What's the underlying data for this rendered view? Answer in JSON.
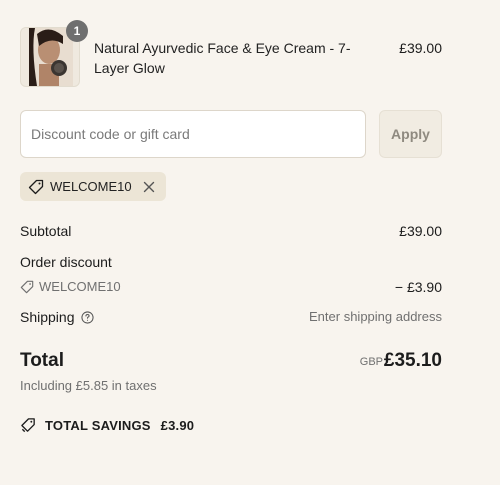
{
  "product": {
    "quantity": "1",
    "title": "Natural Ayurvedic Face & Eye Cream - 7-Layer Glow",
    "price": "£39.00"
  },
  "discount_form": {
    "placeholder": "Discount code or gift card",
    "value": "",
    "apply_label": "Apply"
  },
  "applied_tag": {
    "code": "WELCOME10"
  },
  "summary": {
    "subtotal_label": "Subtotal",
    "subtotal_value": "£39.00",
    "order_discount_label": "Order discount",
    "discount_code": "WELCOME10",
    "discount_amount": "− £3.90",
    "shipping_label": "Shipping",
    "shipping_value": "Enter shipping address",
    "total_label": "Total",
    "currency": "GBP",
    "total_value": "£35.10",
    "taxes_note": "Including £5.85 in taxes",
    "savings_label": "TOTAL SAVINGS",
    "savings_value": "£3.90"
  },
  "colors": {
    "background": "#f8f4ee",
    "tag_background": "#ece5d6",
    "muted_text": "#707070"
  },
  "icons": [
    "tag-icon",
    "close-icon",
    "question-circle-icon",
    "tags-icon"
  ]
}
